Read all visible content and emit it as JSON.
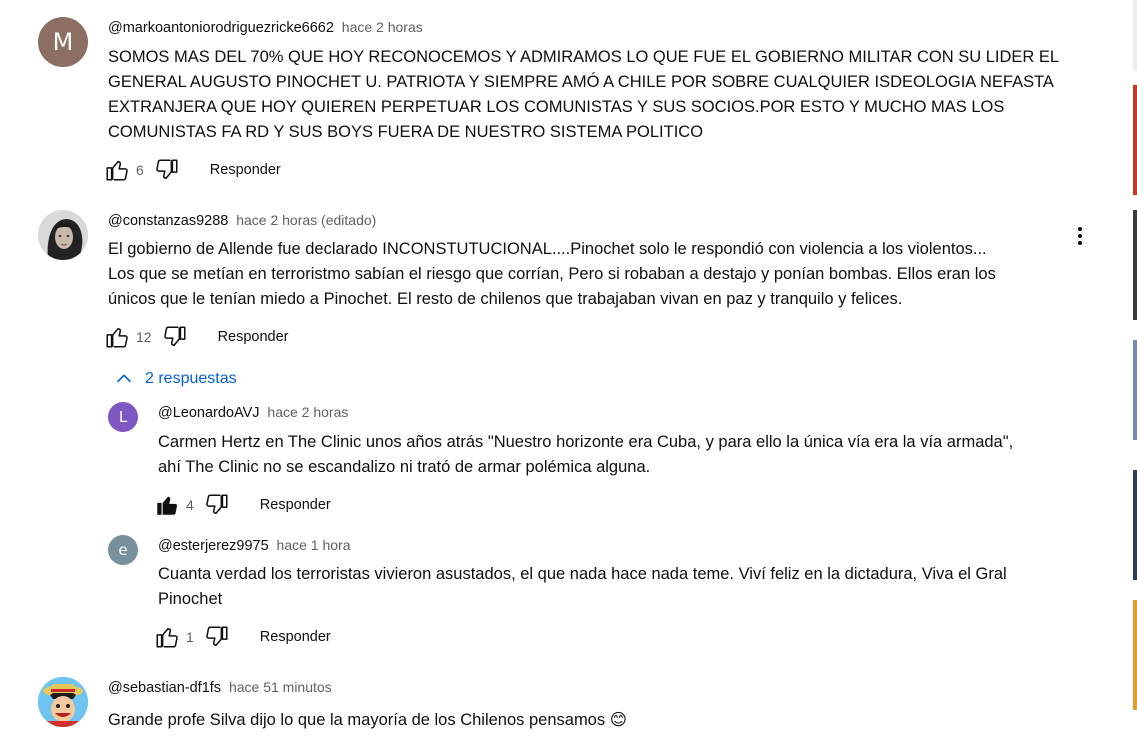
{
  "comments": [
    {
      "author": "@markoantoniorodriguezricke6662",
      "time": "hace 2 horas",
      "avatar_letter": "M",
      "avatar_color": "#8d6e63",
      "text": "SOMOS MAS DEL 70% QUE HOY RECONOCEMOS Y ADMIRAMOS LO QUE FUE EL GOBIERNO MILITAR CON SU LIDER EL\nGENERAL AUGUSTO PINOCHET U. PATRIOTA Y SIEMPRE AMÓ A CHILE POR SOBRE CUALQUIER ISDEOLOGIA NEFASTA\nEXTRANJERA QUE HOY QUIEREN PERPETUAR LOS COMUNISTAS Y SUS SOCIOS.POR ESTO Y MUCHO MAS LOS\nCOMUNISTAS FA RD Y SUS BOYS FUERA DE NUESTRO SISTEMA POLITICO",
      "likes": "6",
      "reply_label": "Responder"
    },
    {
      "author": "@constanzas9288",
      "time": "hace 2 horas (editado)",
      "text": "El gobierno de Allende fue declarado INCONSTUTUCIONAL....Pinochet solo le respondió con violencia a los violentos...\nLos que se metían en terroristmo sabían el riesgo que corrían, Pero si robaban a destajo y ponían bombas.  Ellos eran los\núnicos que le tenían miedo a Pinochet. El  resto de chilenos que trabajaban  vivan en paz y tranquilo y felices.",
      "likes": "12",
      "reply_label": "Responder",
      "replies_toggle": "2 respuestas",
      "replies": [
        {
          "author": "@LeonardoAVJ",
          "time": "hace 2 horas",
          "avatar_letter": "L",
          "avatar_color": "#7e57c2",
          "text": "Carmen Hertz en The Clinic unos años atrás \"Nuestro horizonte era Cuba, y para ello la única vía era la vía armada\",\nahí The Clinic no se escandalizo ni trató de armar polémica alguna.",
          "likes": "4",
          "liked": true,
          "reply_label": "Responder"
        },
        {
          "author": "@esterjerez9975",
          "time": "hace 1 hora",
          "avatar_letter": "e",
          "avatar_color": "#78909c",
          "text": "Cuanta verdad los terroristas vivieron asustados, el que nada hace nada teme. Viví feliz en la dictadura, Viva el Gral\nPinochet",
          "likes": "1",
          "liked": false,
          "reply_label": "Responder"
        }
      ]
    },
    {
      "author": "@sebastian-df1fs",
      "time": "hace 51 minutos",
      "text": "Grande profe Silva dijo lo que la mayoría de los Chilenos pensamos",
      "emoji": "😊"
    }
  ],
  "icons": {
    "like": "thumb-up-icon",
    "dislike": "thumb-down-icon",
    "more": "more-vert-icon",
    "collapse": "chevron-up-icon"
  },
  "colors": {
    "link_blue": "#065fd4",
    "secondary_text": "#606060"
  }
}
